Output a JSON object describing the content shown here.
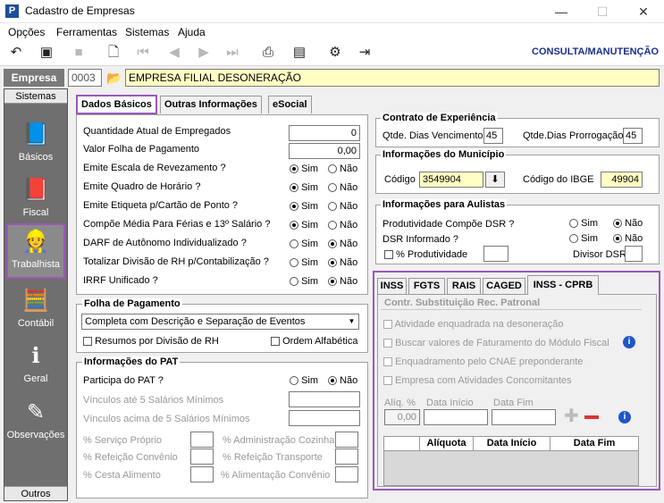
{
  "window": {
    "title": "Cadastro de Empresas",
    "minimize": "—",
    "maximize": "☐",
    "close": "✕"
  },
  "menu": [
    "Opções",
    "Ferramentas",
    "Sistemas",
    "Ajuda"
  ],
  "toolbar": {
    "mode_label": "CONSULTA/MANUTENÇÃO",
    "icons": [
      "undo-icon",
      "save-icon",
      "bookmark-icon",
      "preview-icon",
      "first-icon",
      "prev-icon",
      "next-icon",
      "last-icon",
      "print-icon",
      "report-icon",
      "tools-icon",
      "exit-icon"
    ]
  },
  "empresa": {
    "label": "Empresa",
    "code": "0003",
    "name": "EMPRESA FILIAL DESONERAÇÃO"
  },
  "sidebar": {
    "header": "Sistemas",
    "footer": "Outros",
    "items": [
      {
        "label": "Básicos",
        "icon": "book-icon"
      },
      {
        "label": "Fiscal",
        "icon": "ledger-icon"
      },
      {
        "label": "Trabalhista",
        "icon": "worker-icon",
        "selected": true
      },
      {
        "label": "Contábil",
        "icon": "calculator-icon"
      },
      {
        "label": "Geral",
        "icon": "info-icon"
      },
      {
        "label": "Observações",
        "icon": "notepad-icon"
      }
    ]
  },
  "tabs": [
    "Dados Básicos",
    "Outras Informações",
    "eSocial"
  ],
  "basicos": {
    "qtd_empregados_label": "Quantidade Atual de Empregados",
    "qtd_empregados": "0",
    "valor_folha_label": "Valor Folha de Pagamento",
    "valor_folha": "0,00",
    "sim": "Sim",
    "nao": "Não",
    "questions": [
      {
        "label": "Emite Escala de Revezamento ?",
        "answer": "Sim"
      },
      {
        "label": "Emite Quadro de Horário ?",
        "answer": "Sim"
      },
      {
        "label": "Emite Etiqueta p/Cartão de Ponto ?",
        "answer": "Sim"
      },
      {
        "label": "Compõe Média Para Férias e 13º Salário ?",
        "answer": "Sim"
      },
      {
        "label": "DARF de Autônomo Individualizado ?",
        "answer": "Não"
      },
      {
        "label": "Totalizar Divisão de RH p/Contabilização ?",
        "answer": "Não"
      },
      {
        "label": "IRRF Unificado ?",
        "answer": "Não"
      }
    ]
  },
  "folha": {
    "title": "Folha de Pagamento",
    "selected": "Completa com Descrição e Separação de Eventos",
    "resumos_label": "Resumos por Divisão de RH",
    "ordem_label": "Ordem Alfabética"
  },
  "pat": {
    "title": "Informações do PAT",
    "participa_label": "Participa do PAT ?",
    "participa": "Não",
    "vinc_ate_label": "Vínculos até 5 Salários Mínimos",
    "vinc_acima_label": "Vínculos acima de 5 Salários Mínimos",
    "servico_proprio": "% Serviço Próprio",
    "adm_cozinha": "% Administração Cozinha",
    "refeicao_convenio": "% Refeição Convênio",
    "refeicao_transporte": "% Refeição Transporte",
    "cesta_alimento": "% Cesta Alimento",
    "alimentacao_convenio": "% Alimentação Convênio"
  },
  "contrato": {
    "title": "Contrato de Experiência",
    "dias_venc_label": "Qtde. Dias Vencimento",
    "dias_venc": "45",
    "dias_prorrog_label": "Qtde.Dias Prorrogação",
    "dias_prorrog": "45"
  },
  "municipio": {
    "title": "Informações do Município",
    "codigo_label": "Código",
    "codigo": "3549904",
    "ibge_label": "Código do IBGE",
    "ibge": "49904"
  },
  "aulistas": {
    "title": "Informações para Aulistas",
    "produtividade_label": "Produtividade Compõe DSR ?",
    "produtividade": "Não",
    "dsr_label": "DSR Informado ?",
    "dsr": "Não",
    "perc_prod_label": "% Produtividade",
    "divisor_label": "Divisor DSR"
  },
  "subtabs": [
    "INSS",
    "FGTS",
    "RAIS",
    "CAGED",
    "INSS - CPRB"
  ],
  "cprb": {
    "title": "Contr. Substituição Rec. Patronal",
    "opts": [
      "Atividade enquadrada na desoneração",
      "Buscar valores de Faturamento do Módulo Fiscal",
      "Enquadramento pelo CNAE preponderante",
      "Empresa com Atividades Concomitantes"
    ],
    "aliq_label": "Alíq. %",
    "aliq": "0,00",
    "data_inicio_label": "Data Início",
    "data_fim_label": "Data Fim",
    "grid_headers": [
      "Alíquota",
      "Data Início",
      "Data Fim"
    ]
  },
  "colors": {
    "accent": "#9b59b6",
    "brand": "#1a2f8a"
  }
}
